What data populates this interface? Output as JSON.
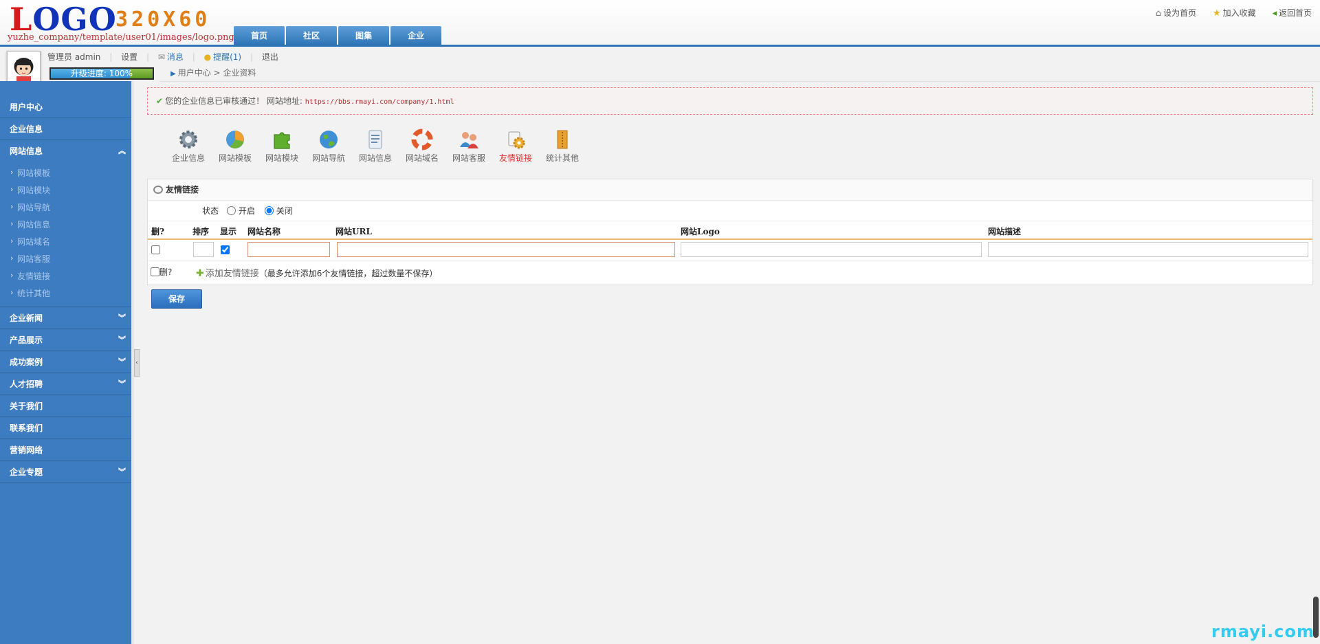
{
  "header": {
    "logo_text_part1": "L",
    "logo_text_part2": "OGO",
    "logo_size": "320X60",
    "logo_path": "yuzhe_company/template/user01/images/logo.png",
    "tabs": [
      {
        "label": "首页"
      },
      {
        "label": "社区"
      },
      {
        "label": "图集"
      },
      {
        "label": "企业"
      }
    ],
    "links": [
      {
        "icon": "home-icon",
        "label": "设为首页"
      },
      {
        "icon": "star-icon",
        "label": "加入收藏"
      },
      {
        "icon": "back-arrow-icon",
        "label": "返回首页"
      }
    ]
  },
  "userbar": {
    "admin_label": "管理员 admin",
    "settings": "设置",
    "messages": "消息",
    "reminders": "提醒(1)",
    "logout": "退出",
    "progress_text": "升级进度: 100%",
    "progress_value": 100,
    "breadcrumb": {
      "home": "用户中心",
      "sep": ">",
      "current": "企业资料"
    }
  },
  "sidebar": {
    "sections_top": [
      {
        "label": "用户中心"
      },
      {
        "label": "企业信息"
      }
    ],
    "expanded": {
      "label": "网站信息",
      "items": [
        "网站模板",
        "网站模块",
        "网站导航",
        "网站信息",
        "网站域名",
        "网站客服",
        "友情链接",
        "统计其他"
      ]
    },
    "sections_bottom": [
      {
        "label": "企业新闻",
        "chevron": true
      },
      {
        "label": "产品展示",
        "chevron": true
      },
      {
        "label": "成功案例",
        "chevron": true
      },
      {
        "label": "人才招聘",
        "chevron": true
      },
      {
        "label": "关于我们",
        "chevron": false
      },
      {
        "label": "联系我们",
        "chevron": false
      },
      {
        "label": "营销网络",
        "chevron": false
      },
      {
        "label": "企业专题",
        "chevron": true
      }
    ]
  },
  "notice": {
    "text": "您的企业信息已审核通过！ 网站地址: ",
    "url": "https://bbs.rmayi.com/company/1.html"
  },
  "icons": [
    {
      "label": "企业信息",
      "icon": "gear-icon",
      "active": false
    },
    {
      "label": "网站模板",
      "icon": "pie-chart-icon",
      "active": false
    },
    {
      "label": "网站模块",
      "icon": "puzzle-icon",
      "active": false
    },
    {
      "label": "网站导航",
      "icon": "globe-icon",
      "active": false
    },
    {
      "label": "网站信息",
      "icon": "document-icon",
      "active": false
    },
    {
      "label": "网站域名",
      "icon": "lifebuoy-icon",
      "active": false
    },
    {
      "label": "网站客服",
      "icon": "users-icon",
      "active": false
    },
    {
      "label": "友情链接",
      "icon": "link-gear-icon",
      "active": true
    },
    {
      "label": "统计其他",
      "icon": "archive-icon",
      "active": false
    }
  ],
  "panel": {
    "title": "友情链接",
    "status_label": "状态",
    "status_options": [
      "开启",
      "关闭"
    ],
    "status_selected": "关闭",
    "columns": [
      "删?",
      "排序",
      "显示",
      "网站名称",
      "网站URL",
      "网站Logo",
      "网站描述"
    ],
    "row": {
      "delete": false,
      "order": "",
      "show": true,
      "name": "",
      "url": "",
      "logo": "",
      "desc": ""
    },
    "delete_all_label": "删?",
    "add_label": "添加友情链接",
    "add_note": "（最多允许添加6个友情链接，超过数量不保存）",
    "save_label": "保存"
  },
  "watermark": "rmayi.com",
  "colors": {
    "accent": "#2f75b5",
    "sidebar": "#3e7cc1",
    "active": "#e03030",
    "notice_border": "#f08080"
  }
}
